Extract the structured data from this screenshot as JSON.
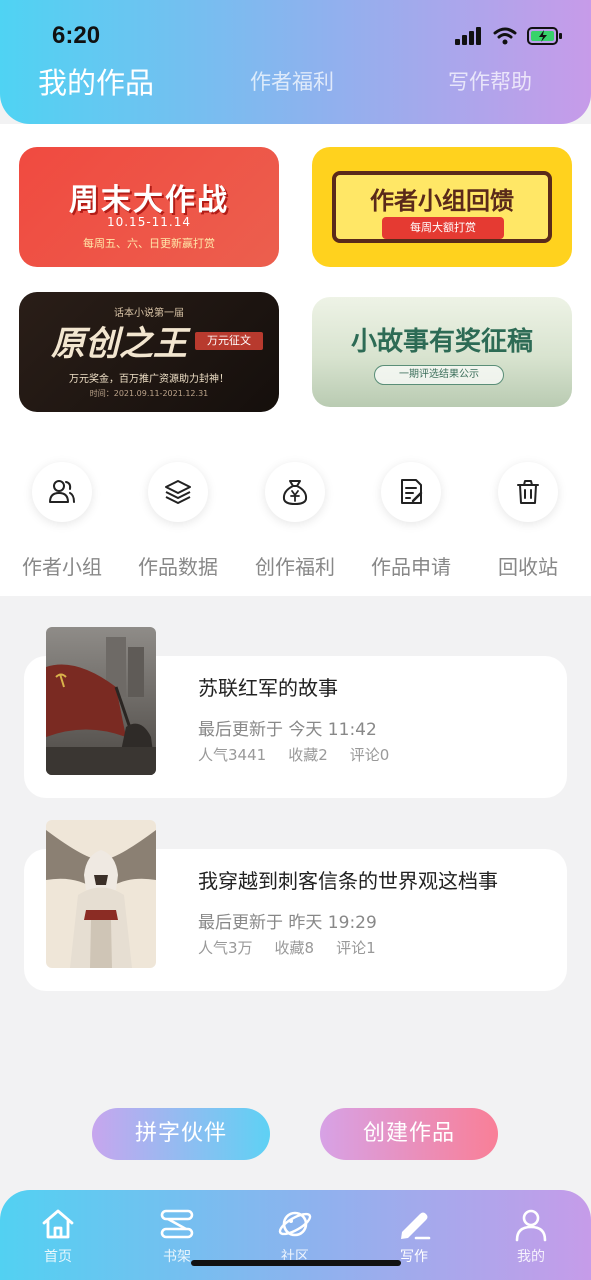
{
  "status_bar": {
    "time": "6:20"
  },
  "top_tabs": [
    {
      "label": "我的作品",
      "active": true
    },
    {
      "label": "作者福利",
      "active": false
    },
    {
      "label": "写作帮助",
      "active": false
    }
  ],
  "banners": [
    {
      "title": "周末大作战",
      "dates": "10.15-11.14",
      "subtitle": "每周五、六、日更新赢打赏"
    },
    {
      "title": "作者小组回馈",
      "subtitle": "每周大额打赏"
    },
    {
      "series": "话本小说第一届",
      "title": "原创之王",
      "badge": "万元征文",
      "subtitle": "万元奖金，百万推广资源助力封神！",
      "period": "时间：2021.09.11-2021.12.31"
    },
    {
      "title": "小故事有奖征稿",
      "subtitle": "一期评选结果公示"
    }
  ],
  "quick_actions": [
    {
      "label": "作者小组",
      "icon": "users-icon"
    },
    {
      "label": "作品数据",
      "icon": "layers-icon"
    },
    {
      "label": "创作福利",
      "icon": "money-bag-icon"
    },
    {
      "label": "作品申请",
      "icon": "document-edit-icon"
    },
    {
      "label": "回收站",
      "icon": "trash-icon"
    }
  ],
  "works": [
    {
      "title": "苏联红军的故事",
      "updated": "最后更新于 今天 11:42",
      "popularity": "人气3441",
      "favorites": "收藏2",
      "comments": "评论0"
    },
    {
      "title": "我穿越到刺客信条的世界观这档事",
      "updated": "最后更新于 昨天 19:29",
      "popularity": "人气3万",
      "favorites": "收藏8",
      "comments": "评论1"
    }
  ],
  "buttons": {
    "partner": "拼字伙伴",
    "create": "创建作品"
  },
  "bottom_nav": [
    {
      "label": "首页",
      "icon": "home-icon",
      "active": false
    },
    {
      "label": "书架",
      "icon": "bookshelf-icon",
      "active": false
    },
    {
      "label": "社区",
      "icon": "planet-icon",
      "active": false
    },
    {
      "label": "写作",
      "icon": "pen-icon",
      "active": true
    },
    {
      "label": "我的",
      "icon": "user-icon",
      "active": false
    }
  ],
  "colors": {
    "header_start": "#4fd3f3",
    "header_end": "#c79be9",
    "accent_pink": "#f97f97"
  }
}
